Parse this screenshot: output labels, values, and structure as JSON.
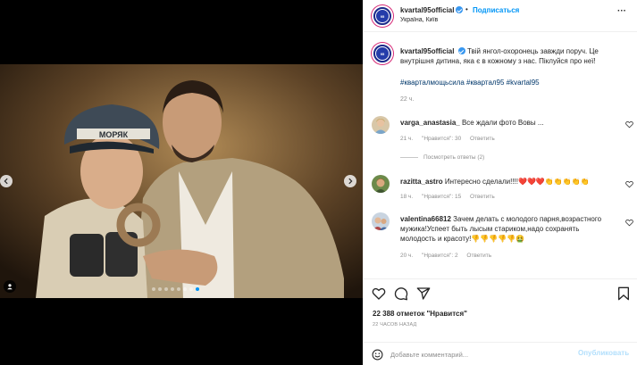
{
  "post": {
    "username": "kvartal95official",
    "follow_label": "Подписаться",
    "dot": "•",
    "location": "Україна, Київ",
    "more_label": "···",
    "caption_text": "Твій янгол-охоронець завжди поруч. Це внутрішня дитина, яка є в кожному з нас. Піклуйся про неї!",
    "hashtags": "#кварталмощьсила #квартал95 #kvartal95",
    "time": "22 ч.",
    "likes": "22 388 отметок \"Нравится\"",
    "post_time": "22 ЧАСОВ НАЗАД",
    "avatar_text": "95",
    "photo_cap_text": "МОРЯК"
  },
  "media": {
    "dots_total": 8,
    "active_dot": 7
  },
  "comments": [
    {
      "username": "varga_anastasia_",
      "text": "Все ждали фото Вовы ...",
      "time": "21 ч.",
      "likes": "\"Нравится\": 30",
      "reply": "Ответить",
      "view_replies": "Посмотреть ответы (2)"
    },
    {
      "username": "razitta_astro",
      "text": "Интересно сделали!!!!❤️❤️❤️👏👏👏👏👏",
      "time": "18 ч.",
      "likes": "\"Нравится\": 15",
      "reply": "Ответить"
    },
    {
      "username": "valentina66812",
      "text": "Зачем делать с молодого парня,возрастного мужика!Успеет быть лысым стариком,надо сохранять молодость и красоту!👎👎👎👎👎🤮",
      "time": "20 ч.",
      "likes": "\"Нравится\": 2",
      "reply": "Ответить"
    }
  ],
  "comment_box": {
    "placeholder": "Добавьте комментарий...",
    "publish_label": "Опубликовать"
  },
  "colors": {
    "accent": "#0095f6",
    "link": "#00376b",
    "muted": "#8e8e8e",
    "publish_disabled": "#b2dffc"
  }
}
